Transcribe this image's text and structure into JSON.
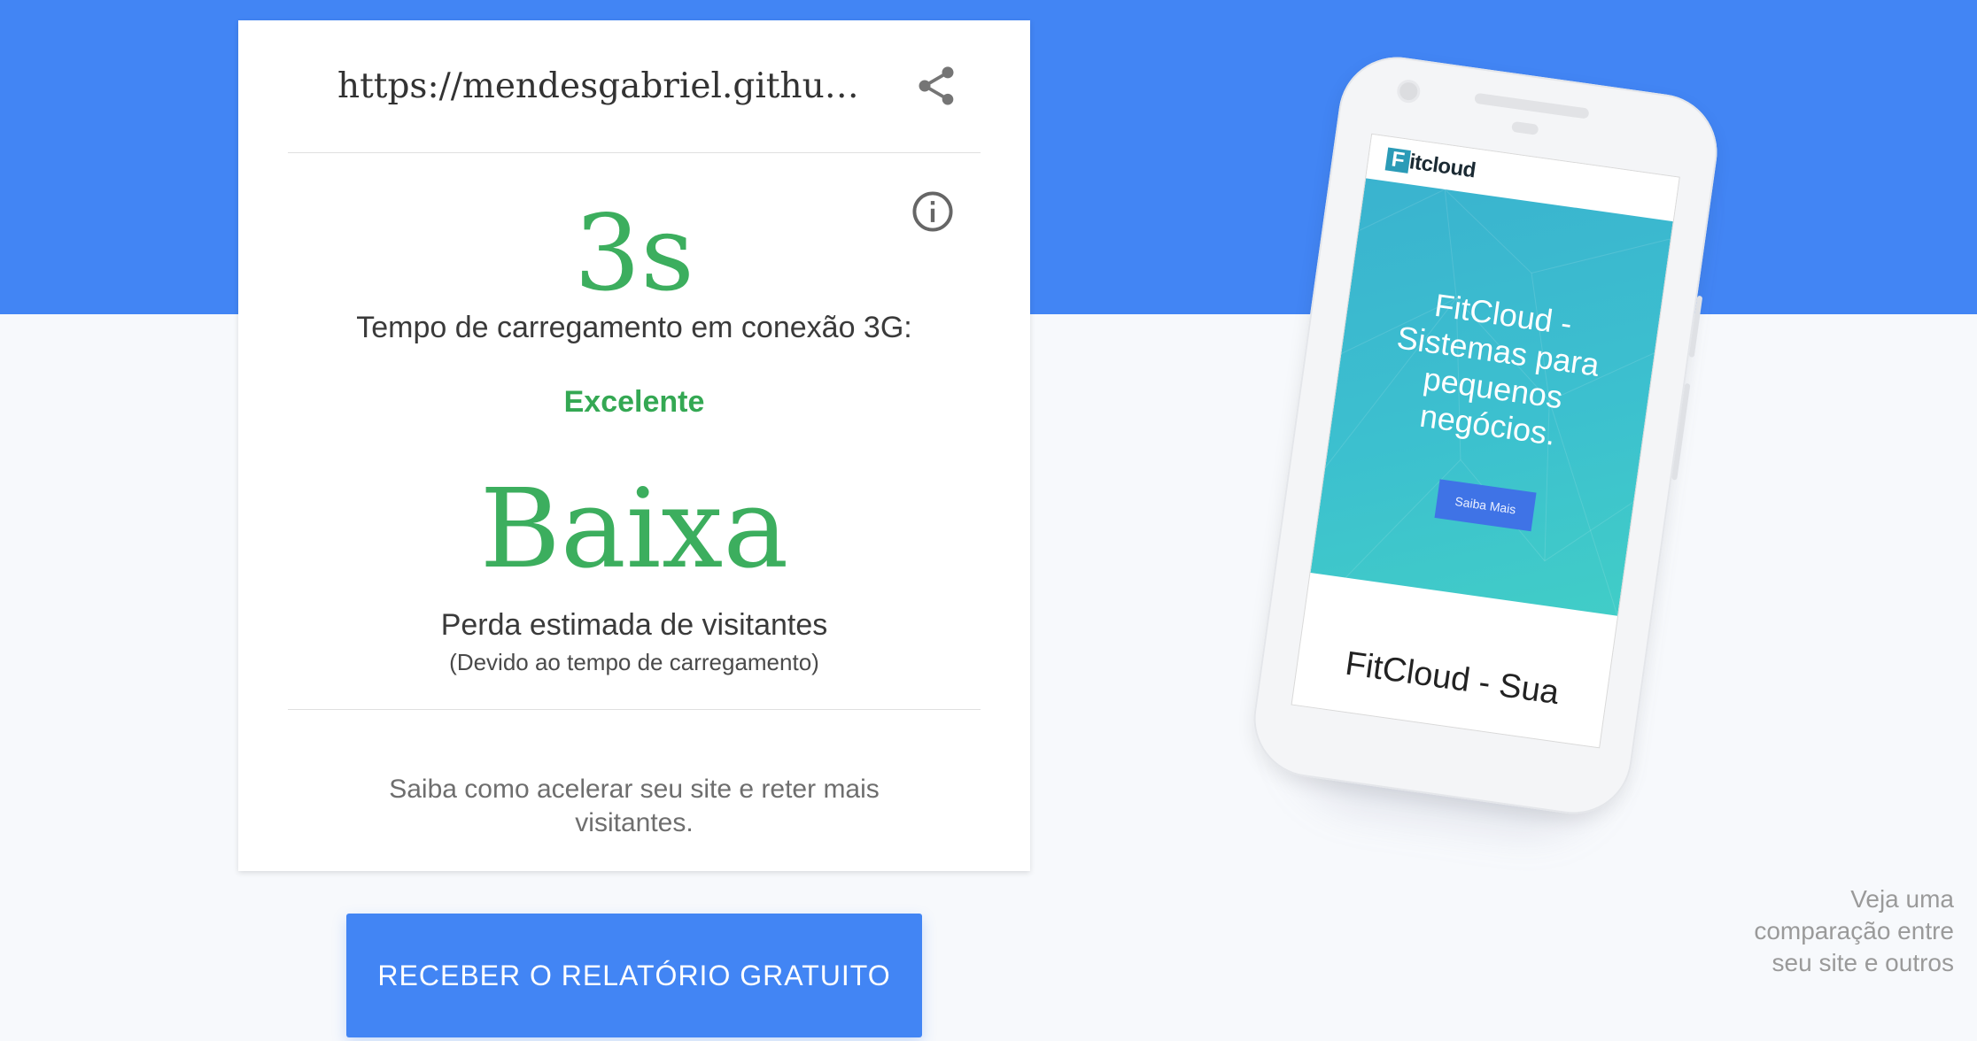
{
  "report": {
    "url": "https://mendesgabriel.githu…",
    "load_time": "3s",
    "load_caption": "Tempo de carregamento em conexão 3G:",
    "rating": "Excelente",
    "loss_level": "Baixa",
    "loss_label": "Perda estimada de visitantes",
    "loss_sub": "(Devido ao tempo de carregamento)",
    "learn_more": "Saiba como acelerar seu site e reter mais visitantes."
  },
  "cta_label": "RECEBER O RELATÓRIO GRATUITO",
  "compare_link": "Veja uma comparação entre seu site e outros",
  "preview": {
    "logo_letter": "F",
    "logo_text": "itcloud",
    "hero_title": "FitCloud - Sistemas para pequenos negócios.",
    "hero_button": "Saiba Mais",
    "section_title": "FitCloud - Sua"
  },
  "icons": {
    "share": "share-icon",
    "info": "info-icon"
  },
  "colors": {
    "brand_blue": "#4285f4",
    "success_green": "#3cae5e",
    "rating_green": "#34a853",
    "hero_teal": "#3cc0cf"
  }
}
